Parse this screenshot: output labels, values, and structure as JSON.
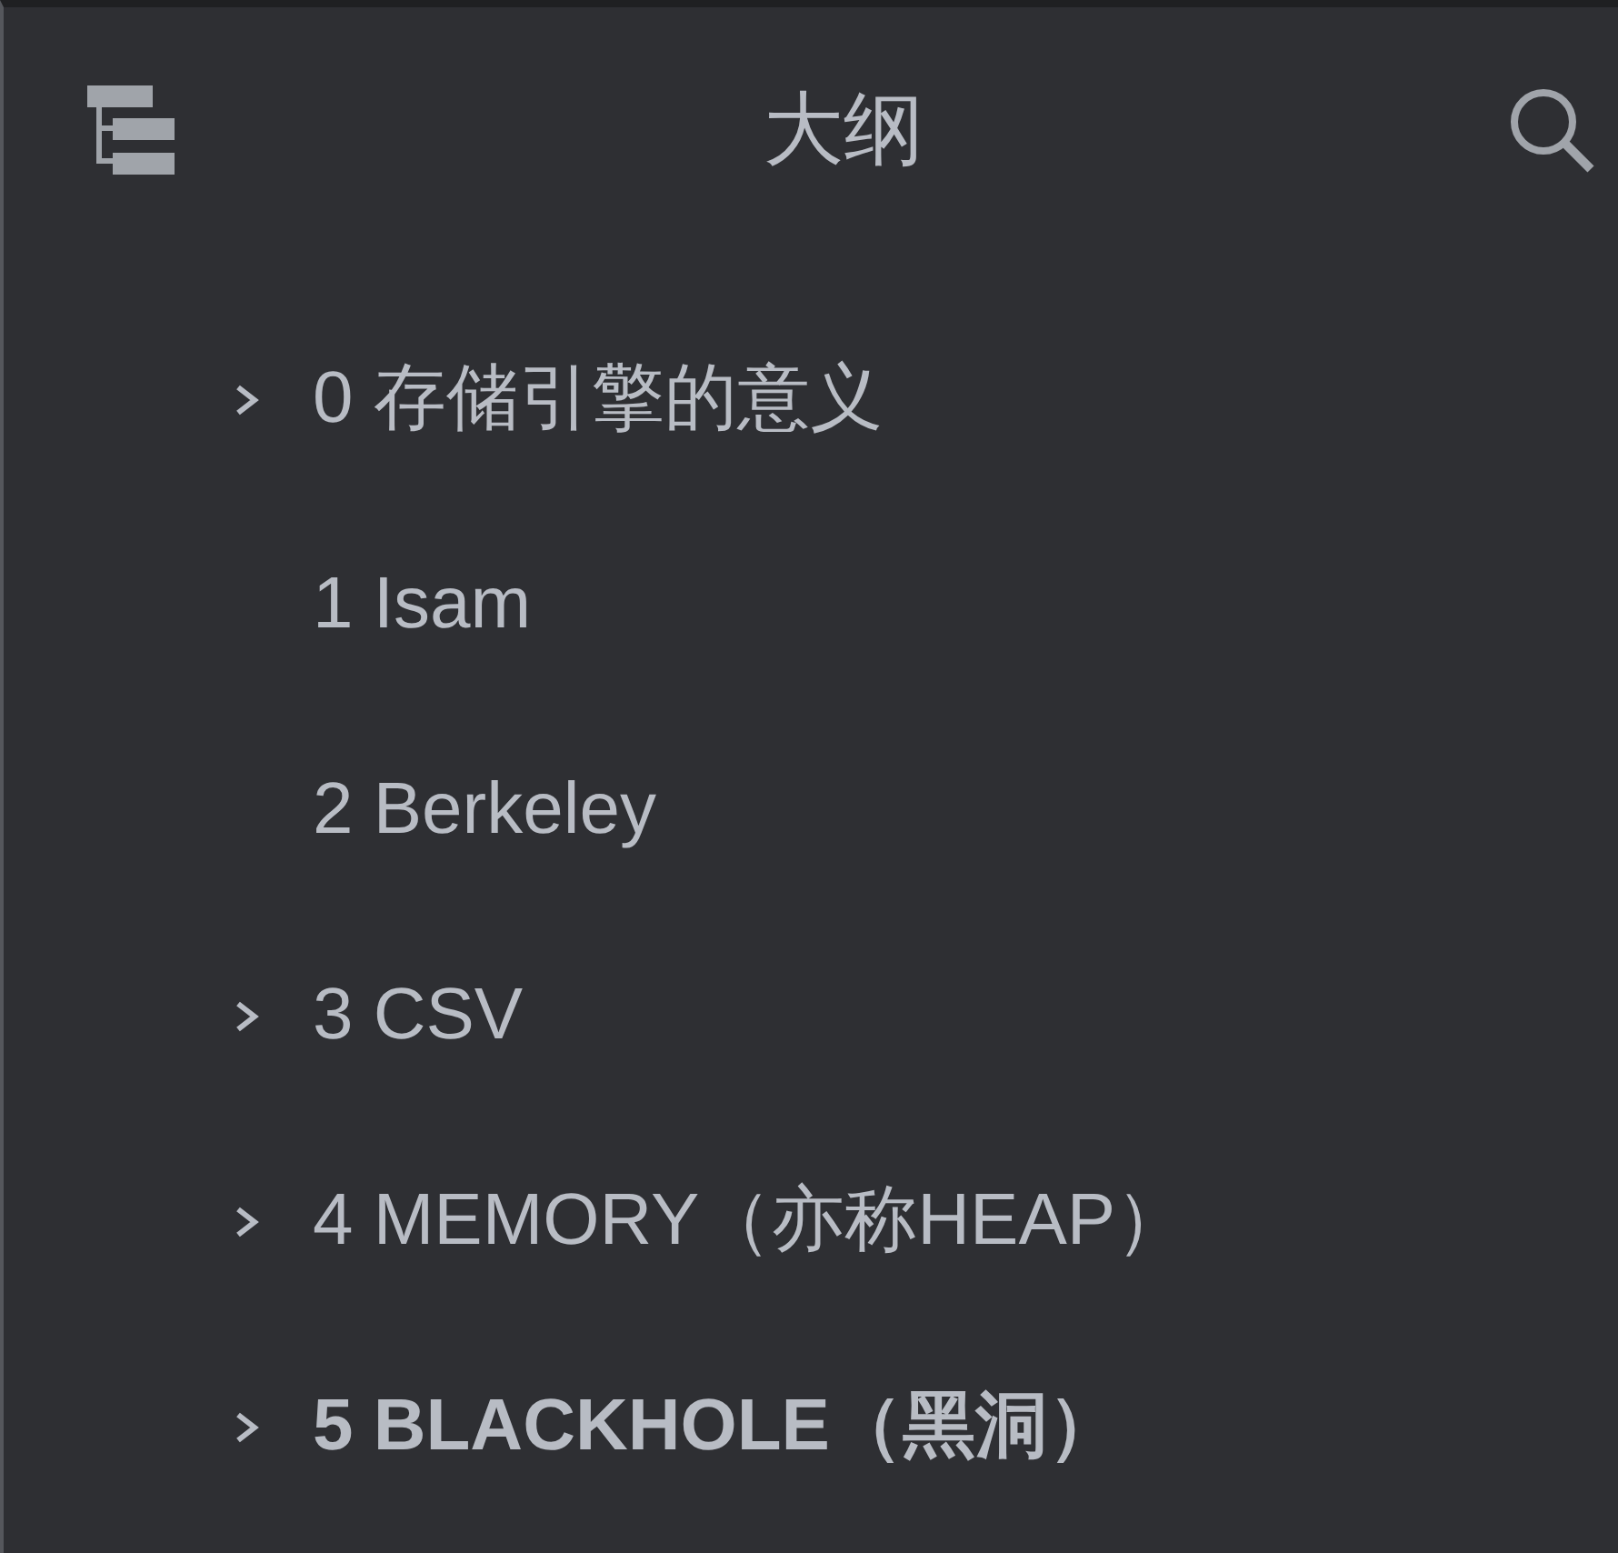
{
  "panel": {
    "title": "大纲"
  },
  "items": [
    {
      "label": "0 存储引擎的意义",
      "expandable": true,
      "selected": false
    },
    {
      "label": "1 Isam",
      "expandable": false,
      "selected": false
    },
    {
      "label": "2 Berkeley",
      "expandable": false,
      "selected": false
    },
    {
      "label": "3 CSV",
      "expandable": true,
      "selected": false
    },
    {
      "label": "4 MEMORY（亦称HEAP）",
      "expandable": true,
      "selected": false
    },
    {
      "label": "5 BLACKHOLE（黑洞）",
      "expandable": true,
      "selected": true
    }
  ]
}
